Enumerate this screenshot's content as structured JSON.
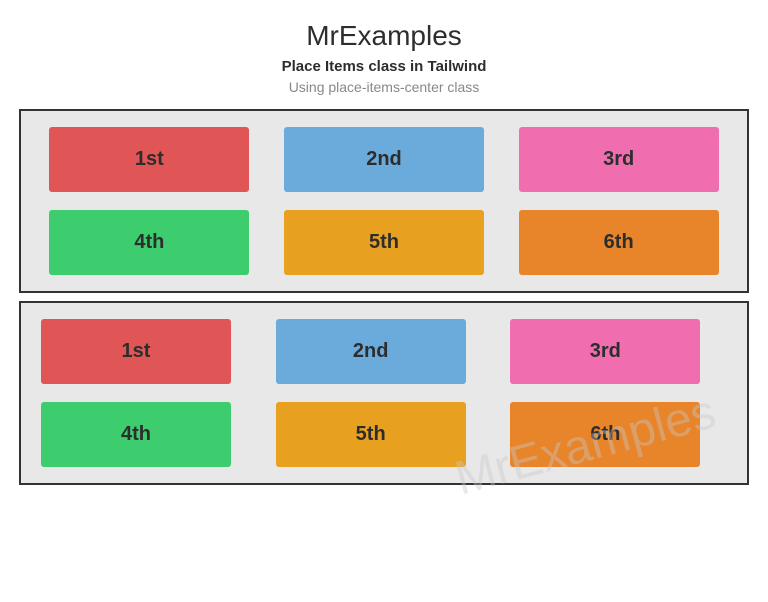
{
  "header": {
    "title": "MrExamples",
    "subtitle": "Place Items class in Tailwind",
    "description": "Using place-items-center class"
  },
  "grid1": {
    "items": [
      {
        "label": "1st",
        "colorClass": "item-1st"
      },
      {
        "label": "2nd",
        "colorClass": "item-2nd"
      },
      {
        "label": "3rd",
        "colorClass": "item-3rd"
      },
      {
        "label": "4th",
        "colorClass": "item-4th"
      },
      {
        "label": "5th",
        "colorClass": "item-5th"
      },
      {
        "label": "6th",
        "colorClass": "item-6th"
      }
    ]
  },
  "grid2": {
    "items": [
      {
        "label": "1st",
        "colorClass": "item-1st"
      },
      {
        "label": "2nd",
        "colorClass": "item-2nd"
      },
      {
        "label": "3rd",
        "colorClass": "item-3rd"
      },
      {
        "label": "4th",
        "colorClass": "item-4th"
      },
      {
        "label": "5th",
        "colorClass": "item-5th"
      },
      {
        "label": "6th",
        "colorClass": "item-6th"
      }
    ]
  }
}
